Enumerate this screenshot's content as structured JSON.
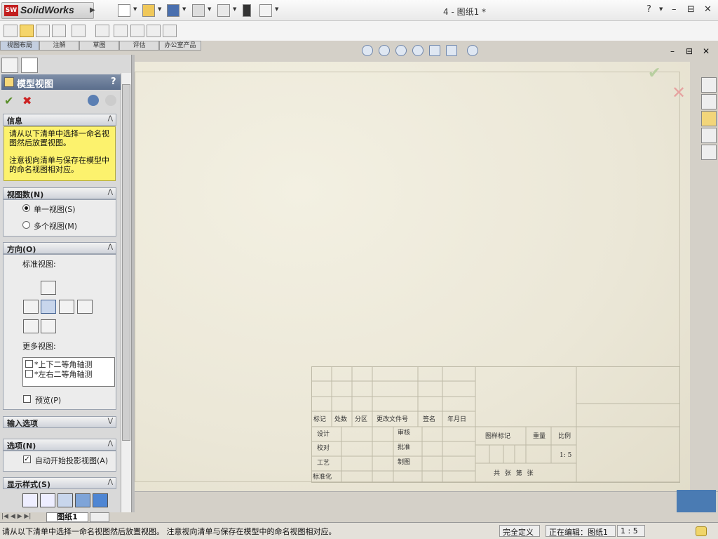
{
  "app": {
    "logo_text": "SolidWorks",
    "logo_badge": "SW",
    "doc_title": "4 - 图纸1 *"
  },
  "titlebar_controls": {
    "help": "?",
    "minimize": "–",
    "restore": "⊟",
    "close": "✕"
  },
  "command_tabs": [
    {
      "label": "视图布局",
      "active": true
    },
    {
      "label": "注解",
      "active": false
    },
    {
      "label": "草图",
      "active": false
    },
    {
      "label": "评估",
      "active": false
    },
    {
      "label": "办公室产品",
      "active": false
    }
  ],
  "property_manager": {
    "title": "模型视图",
    "help": "?",
    "ok_icon": "check-icon",
    "cancel_icon": "x-icon",
    "info": {
      "heading": "信息",
      "line1": "请从以下清单中选择一命名视图然后放置视图。",
      "line2": "注意视向清单与保存在模型中的命名视图相对应。"
    },
    "view_count": {
      "heading": "视图数(N)",
      "single": "单一视图(S)",
      "multiple": "多个视图(M)",
      "selected": "single"
    },
    "orientation": {
      "heading": "方向(O)",
      "standard_label": "标准视图:",
      "more_label": "更多视图:",
      "more_items": [
        "*上下二等角轴测",
        "*左右二等角轴测"
      ],
      "preview": "预览(P)"
    },
    "import_options": {
      "heading": "输入选项"
    },
    "options": {
      "heading": "选项(N)",
      "auto_projection": "自动开始投影视图(A)",
      "auto_checked": true
    },
    "display_style": {
      "heading": "显示样式(S)"
    }
  },
  "title_block": {
    "revision_headers": [
      "标记",
      "处数",
      "分区",
      "更改文件号",
      "签名",
      "年月日"
    ],
    "left_rows": [
      "设计",
      "校对",
      "工艺",
      "标准化"
    ],
    "mid_rows": [
      "审核",
      "批准",
      "制图"
    ],
    "right_headers": [
      "图样标记",
      "重量",
      "比例"
    ],
    "scale_value": "1: 5",
    "sheets": "共  张  第  张"
  },
  "sheet_tabs": {
    "active": "图纸1"
  },
  "status": {
    "message": "请从以下清单中选择一命名视图然后放置视图。 注意视向清单与保存在模型中的命名视图相对应。",
    "defined": "完全定义",
    "editing": "正在编辑：图纸1",
    "scale": "1 : 5"
  }
}
